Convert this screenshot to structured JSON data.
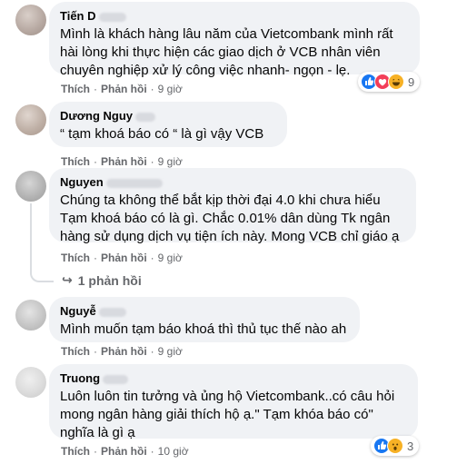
{
  "comments": [
    {
      "author": "Tiến D",
      "lines": [
        "Mình là khách hàng lâu năm của Vietcombank mình rất",
        "hài lòng khi thực hiện các giao dịch ở VCB nhân viên",
        "chuyên nghiệp xử lý công việc nhanh- ngọn - lẹ."
      ],
      "like_label": "Thích",
      "reply_label": "Phản hồi",
      "time": "9 giờ",
      "reactions": {
        "icons": [
          "like",
          "love",
          "haha"
        ],
        "count": "9"
      }
    },
    {
      "author": "Dương Nguy",
      "lines": [
        "“ tạm khoá báo có “ là gì vậy VCB"
      ],
      "like_label": "Thích",
      "reply_label": "Phản hồi",
      "time": "9 giờ"
    },
    {
      "author": "Nguyen",
      "lines": [
        "Chúng ta không thể bắt kịp thời đại 4.0 khi chưa hiểu",
        "Tạm khoá báo có là gì. Chắc 0.01% dân dùng Tk ngân",
        "hàng sử dụng dịch vụ tiện ích này. Mong VCB chỉ giáo ạ"
      ],
      "like_label": "Thích",
      "reply_label": "Phản hồi",
      "time": "9 giờ",
      "replies_link": "1 phản hồi"
    },
    {
      "author": "Nguyễ",
      "lines": [
        "Mình muốn tạm báo khoá thì thủ tục thế nào ah"
      ],
      "like_label": "Thích",
      "reply_label": "Phản hồi",
      "time": "9 giờ"
    },
    {
      "author": "Truong",
      "lines": [
        "Luôn luôn tin tưởng và ủng hộ Vietcombank..có câu hỏi",
        "mong ngân hàng giải thích hộ ạ.\" Tạm khóa báo có\"",
        "nghĩa là gì ạ"
      ],
      "like_label": "Thích",
      "reply_label": "Phản hồi",
      "time": "10 giờ",
      "reactions": {
        "icons": [
          "like",
          "wow"
        ],
        "count": "3"
      }
    }
  ],
  "separator": "·",
  "colors": {
    "bubble": "#f0f2f5",
    "meta": "#65676b",
    "text": "#050505",
    "like": "#1877f2",
    "love": "#f33e58",
    "haha": "#f7b125"
  }
}
